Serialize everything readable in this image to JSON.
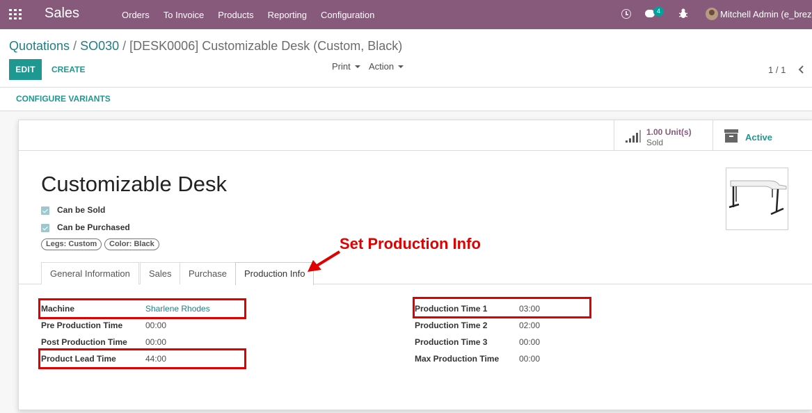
{
  "navbar": {
    "brand": "Sales",
    "menu": [
      "Orders",
      "To Invoice",
      "Products",
      "Reporting",
      "Configuration"
    ],
    "chat_badge": "4",
    "user": "Mitchell Admin (e_brez"
  },
  "breadcrumb": {
    "quotations": "Quotations",
    "sep": "/",
    "order": "SO030",
    "current": "[DESK0006] Customizable Desk (Custom, Black)"
  },
  "toolbar": {
    "edit": "EDIT",
    "create": "CREATE",
    "print": "Print",
    "action": "Action",
    "pager": "1 / 1"
  },
  "configure_variants": "CONFIGURE VARIANTS",
  "smart_buttons": {
    "sold_value": "1.00 Unit(s)",
    "sold_label": "Sold",
    "active_label": "Active"
  },
  "product": {
    "name": "Customizable Desk",
    "can_be_sold": "Can be Sold",
    "can_be_purchased": "Can be Purchased",
    "tags": [
      "Legs: Custom",
      "Color: Black"
    ]
  },
  "tabs": [
    "General Information",
    "Sales",
    "Purchase",
    "Production Info"
  ],
  "production_info": {
    "left": [
      {
        "label": "Machine",
        "value": "Sharlene Rhodes"
      },
      {
        "label": "Pre Production Time",
        "value": "00:00"
      },
      {
        "label": "Post Production Time",
        "value": "00:00"
      },
      {
        "label": "Product Lead Time",
        "value": "44:00"
      }
    ],
    "right": [
      {
        "label": "Production Time 1",
        "value": "03:00"
      },
      {
        "label": "Production Time 2",
        "value": "02:00"
      },
      {
        "label": "Production Time 3",
        "value": "00:00"
      },
      {
        "label": "Max Production Time",
        "value": "00:00"
      }
    ]
  },
  "annotation": "Set Production Info",
  "colors": {
    "navbar": "#875a7b",
    "accent": "#1f9892",
    "annotation": "#e00000"
  }
}
